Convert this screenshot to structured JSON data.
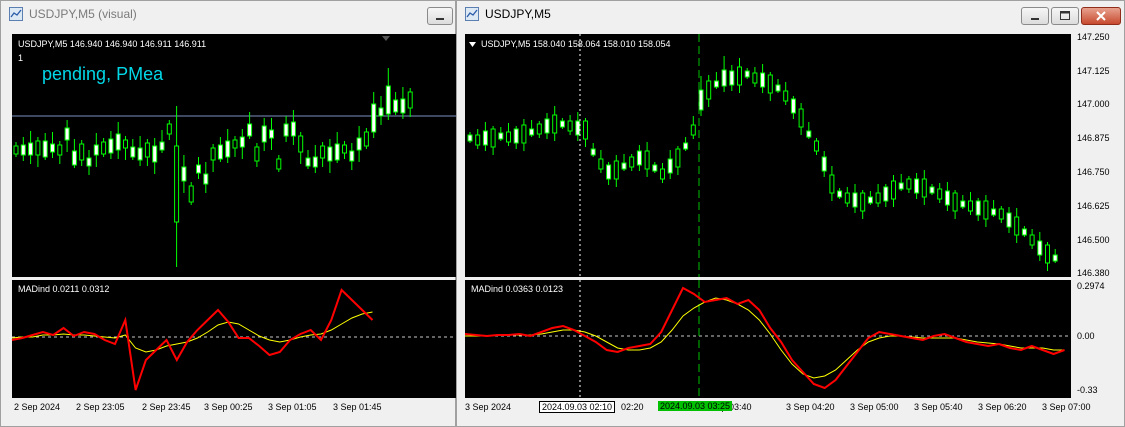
{
  "left_window": {
    "title": "USDJPY,M5 (visual)",
    "price_header": "USDJPY,M5  146.940 146.940 146.911 146.911",
    "index_label": "1",
    "overlay_text": "pending, PMea",
    "indicator_header": "MADind 0.0211 0.0312",
    "x_labels": [
      "2 Sep 2024",
      "2 Sep 23:05",
      "2 Sep 23:45",
      "3 Sep 00:25",
      "3 Sep 01:05",
      "3 Sep 01:45"
    ]
  },
  "right_window": {
    "title": "USDJPY,M5",
    "price_header": "USDJPY,M5  158.040 158.064 158.010 158.054",
    "indicator_header": "MADind 0.0363 0.0123",
    "price_axis": [
      "147.250",
      "147.125",
      "147.000",
      "146.875",
      "146.750",
      "146.625",
      "146.500",
      "146.380"
    ],
    "indicator_axis": [
      "0.2974",
      "0.00",
      "-0.33"
    ],
    "x_labels": [
      "3 Sep 2024",
      "02:20",
      "3 Sep 03:40",
      "3 Sep 04:20",
      "3 Sep 05:00",
      "3 Sep 05:40",
      "3 Sep 06:20",
      "3 Sep 07:00"
    ],
    "cursor_label_1": "2024.09.03 02:10",
    "cursor_label_2": "2024.09.03 03:25"
  },
  "colors": {
    "bull": "#ffffff",
    "bear": "#00ff00",
    "mad_fast": "#ff0000",
    "mad_slow": "#ffff00",
    "cursor_green": "#00c000",
    "level": "#7b8fbf"
  }
}
